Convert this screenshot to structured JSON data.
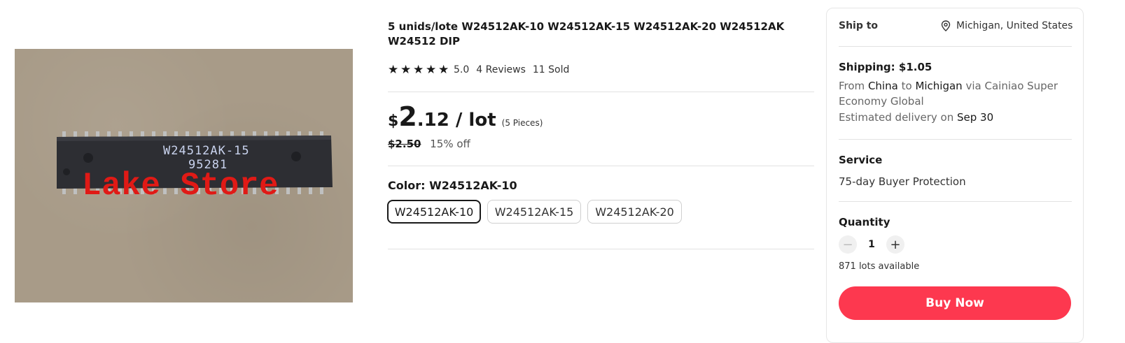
{
  "product": {
    "title": "5 unids/lote W24512AK-10 W24512AK-15 W24512AK-20 W24512AK W24512 DIP",
    "image": {
      "chip_marking_line1": "W24512AK-15",
      "chip_marking_line2": "95281",
      "watermark": "Lake Store"
    },
    "rating": {
      "stars": 5,
      "score": "5.0",
      "reviews": "4 Reviews",
      "sold": "11 Sold"
    },
    "price": {
      "currency": "$",
      "integer": "2",
      "decimal_unit": ".12 / lot",
      "pieces": "(5 Pieces)",
      "original": "$2.50",
      "discount": "15% off"
    },
    "color": {
      "label": "Color: W24512AK-10",
      "options": [
        "W24512AK-10",
        "W24512AK-15",
        "W24512AK-20"
      ],
      "selected": "W24512AK-10"
    }
  },
  "shipping_panel": {
    "ship_to_label": "Ship to",
    "ship_to_location": "Michigan, United States",
    "shipping_cost": "Shipping: $1.05",
    "from_prefix": "From",
    "from_country": "China",
    "to_word": "to",
    "to_location": "Michigan",
    "via_text": "via Cainiao Super Economy Global",
    "delivery_prefix": "Estimated delivery on",
    "delivery_date": "Sep 30",
    "service_label": "Service",
    "service_value": "75-day Buyer Protection",
    "quantity_label": "Quantity",
    "quantity_value": "1",
    "decrement_symbol": "−",
    "increment_symbol": "+",
    "availability": "871 lots available",
    "buy_button": "Buy Now"
  },
  "colors": {
    "buy_button_bg": "#fd384f",
    "text_primary": "#191919",
    "text_secondary": "#666666",
    "watermark": "#e01a16"
  },
  "icons": [
    "location-pin-icon",
    "star-icon",
    "minus-icon",
    "plus-icon"
  ]
}
